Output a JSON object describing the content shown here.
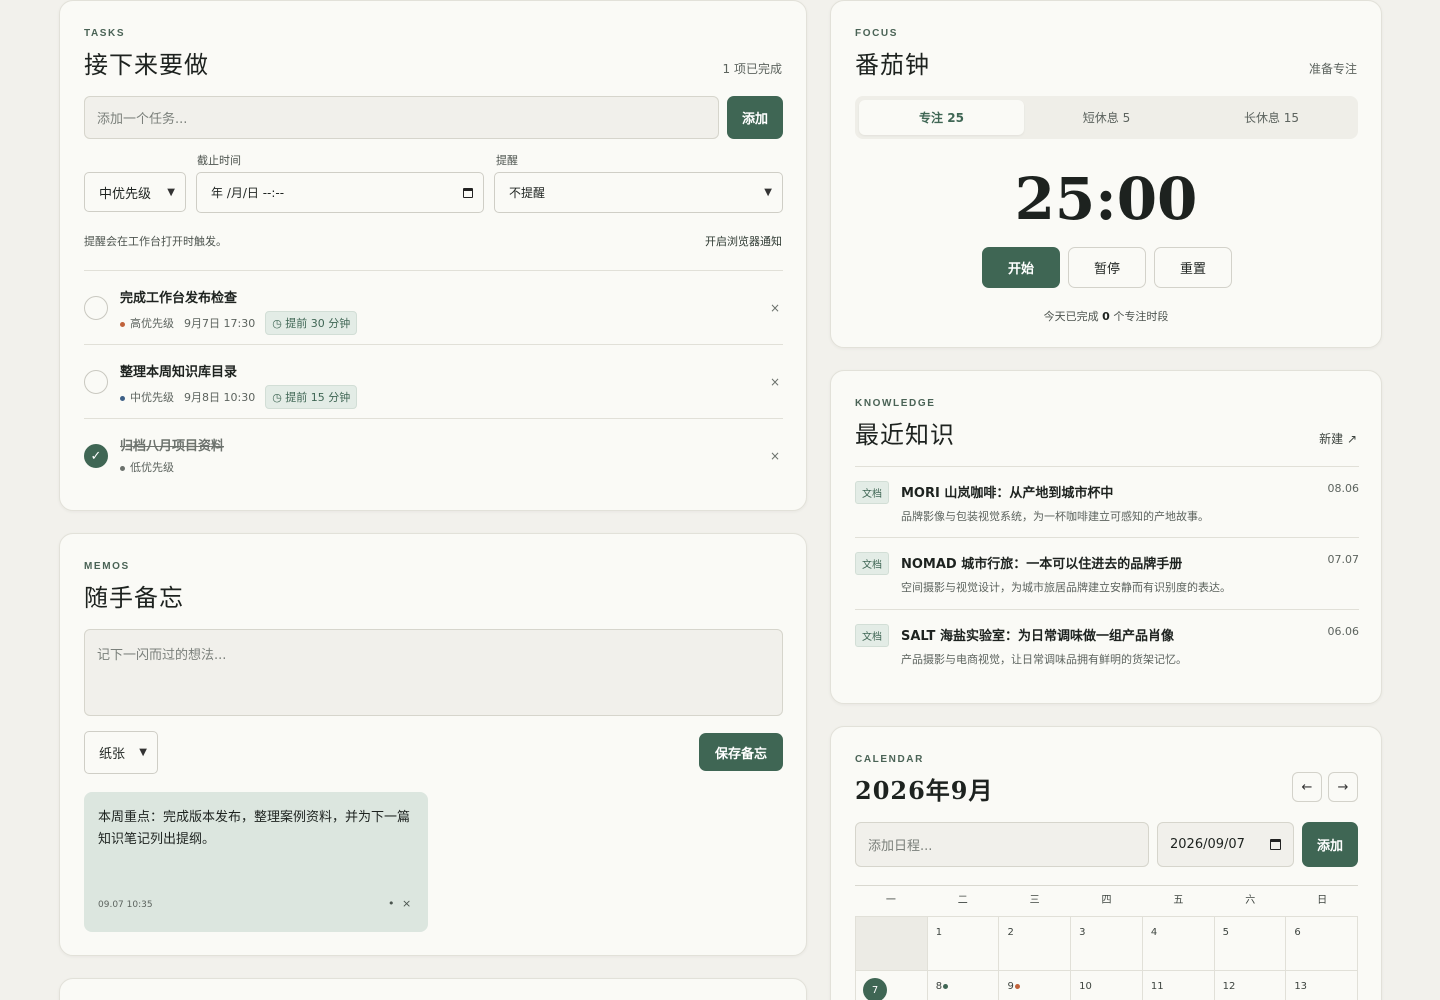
{
  "tasks": {
    "eyebrow": "TASKS",
    "title": "接下来要做",
    "completed_count": "1 项已完成",
    "input_placeholder": "添加一个任务...",
    "add_label": "添加",
    "priority_selected": "中优先级",
    "deadline_label": "截止时间",
    "deadline_value": "年 /月/日 --:--",
    "reminder_label": "提醒",
    "reminder_selected": "不提醒",
    "reminder_hint": "提醒会在工作台打开时触发。",
    "enable_notify": "开启浏览器通知",
    "items": [
      {
        "title": "完成工作台发布检查",
        "priority": "高优先级",
        "priority_color": "#c0623b",
        "due": "9月7日 17:30",
        "remind": "◷ 提前 30 分钟",
        "done": false
      },
      {
        "title": "整理本周知识库目录",
        "priority": "中优先级",
        "priority_color": "#3d5f86",
        "due": "9月8日 10:30",
        "remind": "◷ 提前 15 分钟",
        "done": false
      },
      {
        "title": "归档八月项目资料",
        "priority": "低优先级",
        "priority_color": "#6b716c",
        "due": "",
        "remind": "",
        "done": true
      }
    ],
    "delete_icon": "×",
    "check_icon": "✓"
  },
  "memos": {
    "eyebrow": "MEMOS",
    "title": "随手备忘",
    "placeholder": "记下一闪而过的想法...",
    "style_selected": "纸张",
    "save_label": "保存备忘",
    "notes": [
      {
        "text": "本周重点：完成版本发布，整理案例资料，并为下一篇知识笔记列出提纲。",
        "time": "09.07 10:35",
        "dot": "•",
        "close": "×"
      }
    ]
  },
  "focus": {
    "eyebrow": "FOCUS",
    "title": "番茄钟",
    "status": "准备专注",
    "tabs": [
      "专注 25",
      "短休息 5",
      "长休息 15"
    ],
    "timer": "25:00",
    "start": "开始",
    "pause": "暂停",
    "reset": "重置",
    "summary_prefix": "今天已完成",
    "summary_count": "0",
    "summary_suffix": "个专注时段"
  },
  "knowledge": {
    "eyebrow": "KNOWLEDGE",
    "title": "最近知识",
    "new_label": "新建 ↗",
    "items": [
      {
        "tag": "文档",
        "title": "MORI 山岚咖啡：从产地到城市杯中",
        "desc": "品牌影像与包装视觉系统，为一杯咖啡建立可感知的产地故事。",
        "date": "08.06"
      },
      {
        "tag": "文档",
        "title": "NOMAD 城市行旅：一本可以住进去的品牌手册",
        "desc": "空间摄影与视觉设计，为城市旅居品牌建立安静而有识别度的表达。",
        "date": "07.07"
      },
      {
        "tag": "文档",
        "title": "SALT 海盐实验室：为日常调味做一组产品肖像",
        "desc": "产品摄影与电商视觉，让日常调味品拥有鲜明的货架记忆。",
        "date": "06.06"
      }
    ]
  },
  "calendar": {
    "eyebrow": "CALENDAR",
    "title": "2026年9月",
    "prev": "←",
    "next": "→",
    "event_placeholder": "添加日程...",
    "date_value": "2026/09/07",
    "add_label": "添加",
    "weekdays": [
      "一",
      "二",
      "三",
      "四",
      "五",
      "六",
      "日"
    ],
    "row1": [
      "",
      "1",
      "2",
      "3",
      "4",
      "5",
      "6"
    ],
    "row2": [
      "7",
      "8",
      "9",
      "10",
      "11",
      "12",
      "13"
    ],
    "event_colors": {
      "8": "#3f6654",
      "9": "#c0623b"
    }
  },
  "colors": {
    "accent": "#3f6654",
    "high": "#c0623b",
    "mid": "#3d5f86",
    "low": "#6b716c"
  }
}
